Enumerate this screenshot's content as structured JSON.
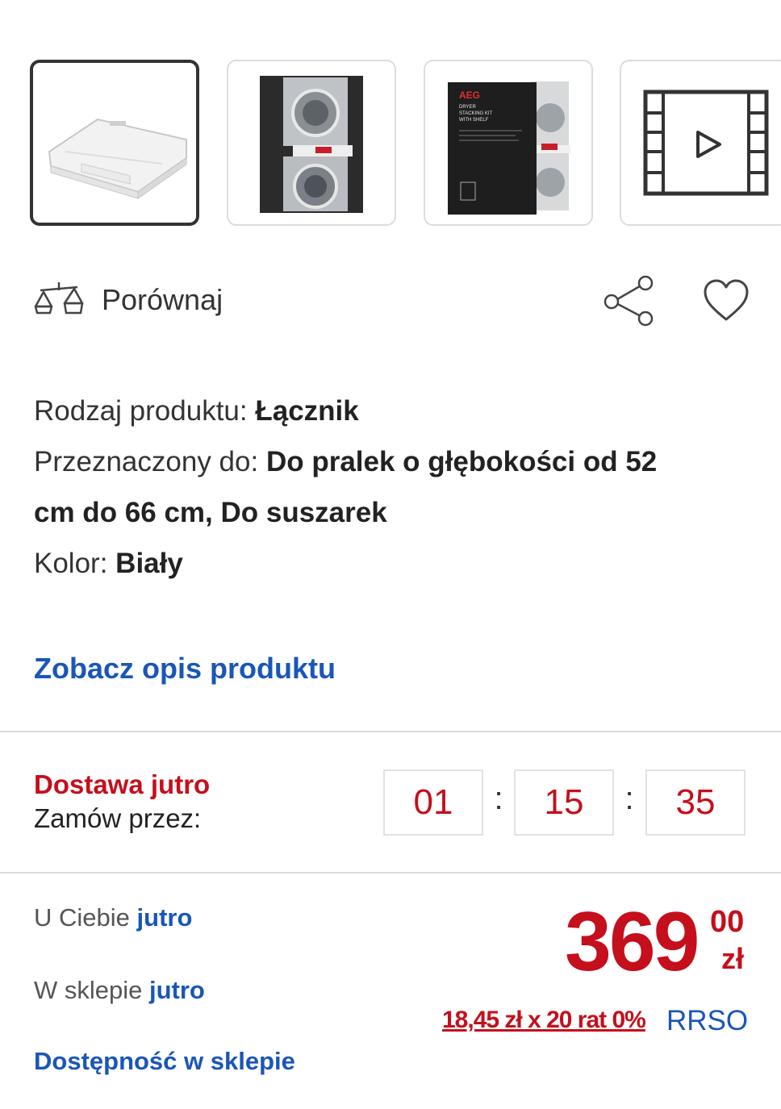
{
  "gallery": {
    "items": [
      {
        "name": "product-photo-shelf",
        "selected": true
      },
      {
        "name": "photo-stacked-machines",
        "selected": false
      },
      {
        "name": "photo-aeg-box",
        "selected": false,
        "box_lines": [
          "AEG",
          "DRYER",
          "STACKING KIT",
          "WITH SHELF"
        ]
      },
      {
        "name": "video-icon",
        "selected": false
      }
    ]
  },
  "actions": {
    "compare_label": "Porównaj",
    "compare_icon": "scales-icon",
    "share_icon": "share-icon",
    "favorite_icon": "heart-icon"
  },
  "specs": {
    "type_label": "Rodzaj produktu:",
    "type_value": "Łącznik",
    "purpose_label": "Przeznaczony do:",
    "purpose_value_line1": "Do pralek o głębokości od 52",
    "purpose_value_line2": "cm do 66 cm, Do suszarek",
    "color_label": "Kolor:",
    "color_value": "Biały"
  },
  "description_link": "Zobacz opis produktu",
  "delivery": {
    "title": "Dostawa jutro",
    "order_by": "Zamów przez:",
    "countdown": {
      "hours": "01",
      "minutes": "15",
      "seconds": "35",
      "separator": ":"
    }
  },
  "availability": {
    "home_label": "U Ciebie",
    "home_value": "jutro",
    "store_label": "W sklepie",
    "store_value": "jutro",
    "store_link": "Dostępność w sklepie"
  },
  "price": {
    "integer": "369",
    "decimal": "00",
    "currency": "zł",
    "installment": "18,45 zł x 20 rat 0%",
    "rrso": "RRSO"
  },
  "colors": {
    "accent_red": "#c50f1c",
    "link_blue": "#1a56b8",
    "text_dark": "#333333"
  }
}
